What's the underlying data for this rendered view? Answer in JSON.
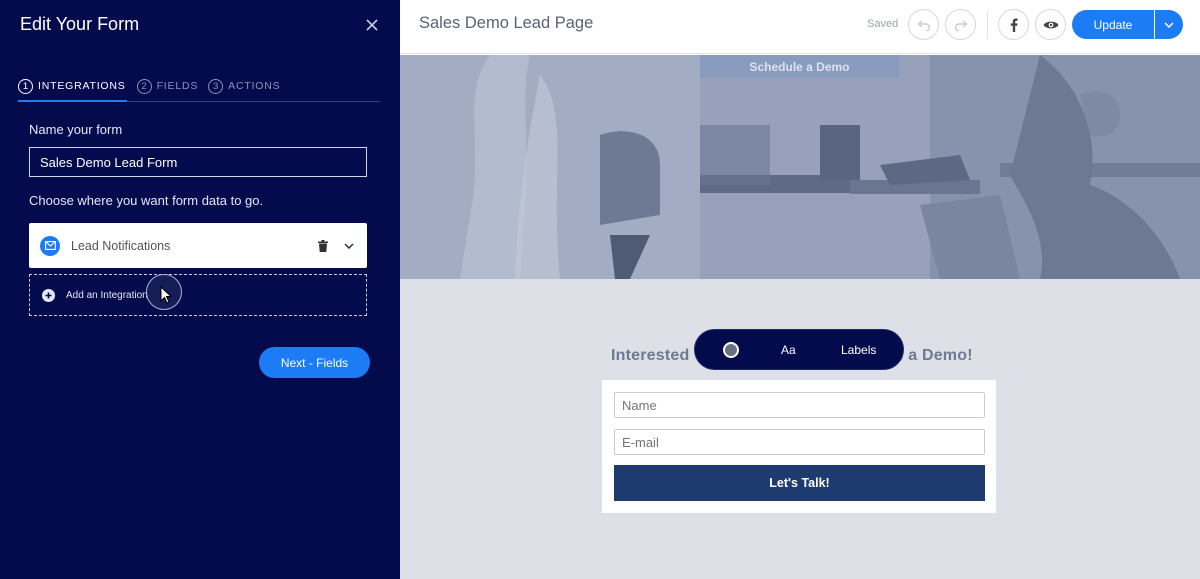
{
  "editor": {
    "title": "Edit Your Form",
    "steps": [
      {
        "num": "1",
        "label": "INTEGRATIONS"
      },
      {
        "num": "2",
        "label": "FIELDS"
      },
      {
        "num": "3",
        "label": "ACTIONS"
      }
    ],
    "name_label": "Name your form",
    "name_value": "Sales Demo Lead Form",
    "choose_label": "Choose where you want form data to go.",
    "integration_label": "Lead Notifications",
    "add_integration_label": "Add an Integration",
    "next_label": "Next - Fields"
  },
  "topbar": {
    "page_title": "Sales Demo Lead Page",
    "saved_label": "Saved",
    "update_label": "Update"
  },
  "canvas": {
    "hero_button": "Schedule a Demo",
    "heading_left": "Interested",
    "heading_right": "e a Demo!",
    "fields": [
      {
        "placeholder": "Name"
      },
      {
        "placeholder": "E-mail"
      }
    ],
    "submit_label": "Let's Talk!",
    "pill": {
      "aa_label": "Aa",
      "labels_label": "Labels"
    }
  },
  "colors": {
    "panel_bg": "#030b4d",
    "accent": "#1b7cf5",
    "submit_bg": "#1d3b6f"
  }
}
